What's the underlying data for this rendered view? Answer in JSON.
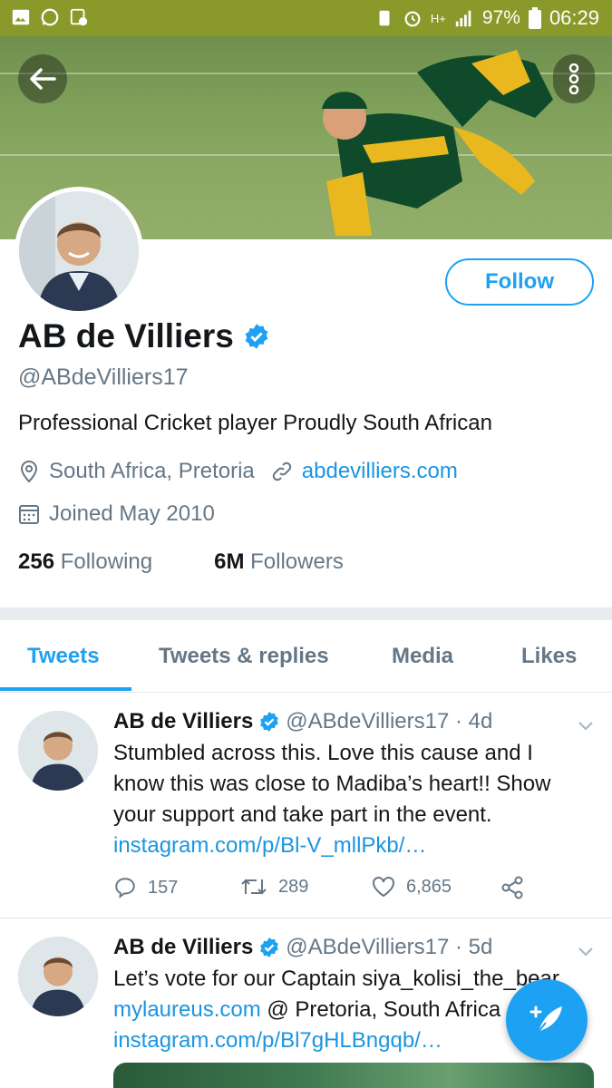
{
  "status_bar": {
    "battery": "97%",
    "time": "06:29",
    "network": "H+"
  },
  "profile": {
    "name": "AB de Villiers",
    "handle": "@ABdeVilliers17",
    "bio": "Professional Cricket player Proudly South African",
    "location": "South Africa, Pretoria",
    "website": "abdevilliers.com",
    "joined": "Joined May 2010",
    "following_count": "256",
    "following_label": "Following",
    "followers_count": "6M",
    "followers_label": "Followers",
    "follow_button": "Follow"
  },
  "tabs": [
    {
      "label": "Tweets",
      "active": true
    },
    {
      "label": "Tweets & replies",
      "active": false
    },
    {
      "label": "Media",
      "active": false
    },
    {
      "label": "Likes",
      "active": false
    }
  ],
  "tweets": [
    {
      "name": "AB de Villiers",
      "handle": "@ABdeVilliers17 · 4d",
      "lines": [
        "Stumbled across this. Love this cause and I",
        "know this was close to Madiba’s heart!! Show",
        "your support and take part in the event."
      ],
      "link": "instagram.com/p/Bl-V_mllPkb/…",
      "replies": "157",
      "retweets": "289",
      "likes": "6,865"
    },
    {
      "name": "AB de Villiers",
      "handle": "@ABdeVilliers17 · 5d",
      "line1": "Let’s vote for our Captain siya_kolisi_the_bear",
      "line2_link": "mylaureus.com",
      "line2_rest": " @ Pretoria, South Africa",
      "link": "instagram.com/p/Bl7gHLBngqb/…"
    }
  ],
  "colors": {
    "accent": "#1da1f2",
    "muted": "#657786",
    "status_bar": "#8a9a2a"
  }
}
